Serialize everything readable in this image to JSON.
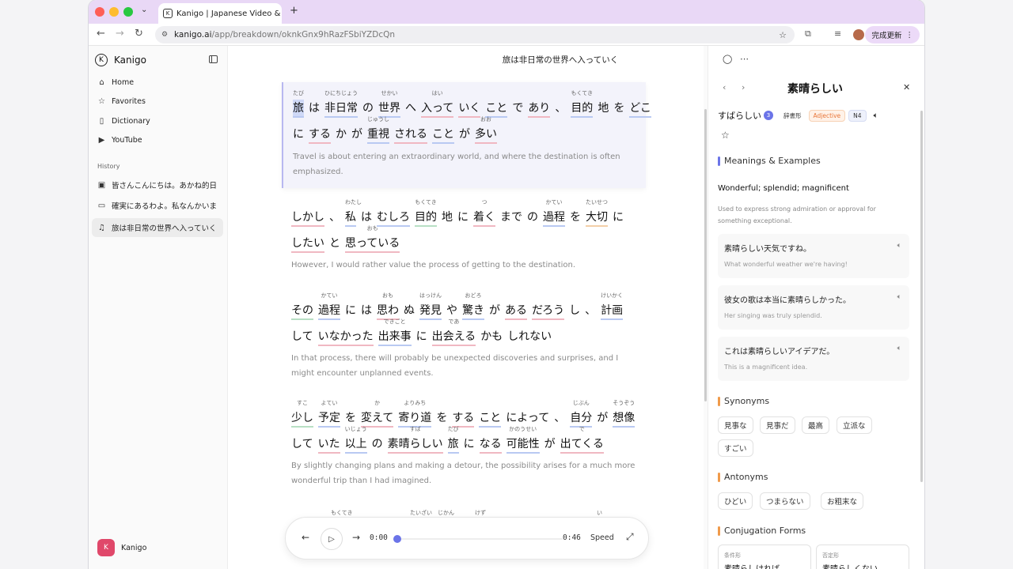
{
  "browser": {
    "tab_title": "Kanigo | Japanese Video & Sc",
    "url_host": "kanigo.ai",
    "url_path": "/app/breakdown/oknkGnx9hRazFSbiYZDcQn",
    "update_label": "完成更新"
  },
  "sidebar": {
    "brand": "Kanigo",
    "nav": [
      {
        "label": "Home",
        "icon": "home-icon"
      },
      {
        "label": "Favorites",
        "icon": "star-icon"
      },
      {
        "label": "Dictionary",
        "icon": "book-icon"
      },
      {
        "label": "YouTube",
        "icon": "youtube-icon"
      }
    ],
    "history_label": "History",
    "history": [
      {
        "label": "皆さんこんにちは。あかね的日",
        "icon": "video-icon"
      },
      {
        "label": "確実にあるわよ。私なんかいま",
        "icon": "camera-icon"
      },
      {
        "label": "旅は非日常の世界へ入っていく",
        "icon": "music-icon"
      }
    ],
    "user_initial": "K",
    "user_name": "Kanigo"
  },
  "main": {
    "page_title": "旅は非日常の世界へ入っていく",
    "translations": [
      "Travel is about entering an extraordinary world, and where the destination is often emphasized.",
      "However, I would rather value the process of getting to the destination.",
      "In that process, there will probably be unexpected discoveries and surprises, and I might encounter unplanned events.",
      "By slightly changing plans and making a detour, the possibility arises for a much more wonderful trip than I had imagined."
    ],
    "player": {
      "current": "0:00",
      "duration": "0:46",
      "speed_label": "Speed",
      "progress": 0
    }
  },
  "dictionary": {
    "word": "素晴らしい",
    "reading": "すばらしい",
    "count": "3",
    "form": "辞書形",
    "pos": "Adjective",
    "level": "N4",
    "meanings_title": "Meanings & Examples",
    "meaning": "Wonderful; splendid; magnificent",
    "meaning_note": "Used to express strong admiration or approval for something exceptional.",
    "examples": [
      {
        "jp": "素晴らしい天気ですね。",
        "en": "What wonderful weather we're having!"
      },
      {
        "jp": "彼女の歌は本当に素晴らしかった。",
        "en": "Her singing was truly splendid."
      },
      {
        "jp": "これは素晴らしいアイデアだ。",
        "en": "This is a magnificent idea."
      }
    ],
    "synonyms_title": "Synonyms",
    "synonyms": [
      "見事な",
      "見事だ",
      "最高",
      "立派な",
      "すごい"
    ],
    "antonyms_title": "Antonyms",
    "antonyms": [
      "ひどい",
      "つまらない",
      "お粗末な"
    ],
    "conjugation_title": "Conjugation Forms",
    "conjugations": [
      {
        "label": "条件形",
        "value": "素晴らしければ"
      },
      {
        "label": "否定形",
        "value": "素晴らしくない"
      }
    ]
  },
  "colors": {
    "accent": "#6b74e8",
    "tabbar": "#e9d8f6",
    "brand": "#e0486a"
  }
}
